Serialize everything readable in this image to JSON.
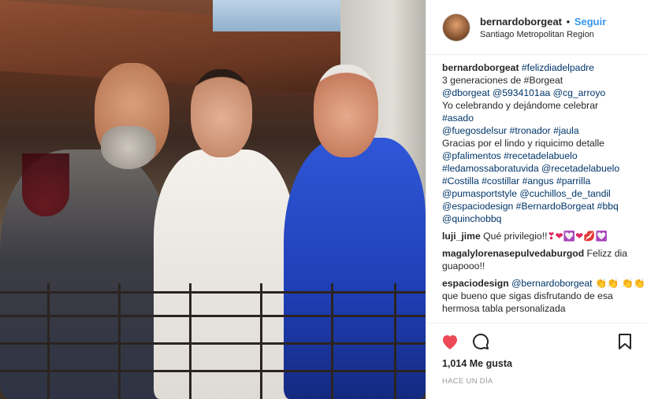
{
  "header": {
    "username": "bernardoborgeat",
    "dot": "•",
    "follow_label": "Seguir",
    "location": "Santiago Metropolitan Region"
  },
  "caption": {
    "username": "bernardoborgeat",
    "lines": [
      "#felizdiadelpadre",
      "3 generaciones de #Borgeat",
      "@dborgeat @5934101aa @cg_arroyo",
      "Yo celebrando y dejándome celebrar",
      "#asado",
      "@fuegosdelsur #tronador #jaula",
      "Gracias por el lindo y riquicimo detalle",
      "@pfalimentos #recetadelabuelo",
      "#ledamossaboratuvida @recetadelabuelo",
      "#Costilla #costillar #angus #parrilla",
      "@pumasportstyle @cuchillos_de_tandil",
      "@espaciodesign #BernardoBorgeat #bbq",
      "@quinchobbq"
    ]
  },
  "comments": [
    {
      "user": "luji_jime",
      "text": "Qué privilegio!!",
      "emoji": "❣❤💟❤💋💟"
    },
    {
      "user": "magalylorenasepulvedaburgod",
      "text": "Felizz dia guapooo!!"
    },
    {
      "user": "espaciodesign",
      "mention": "@bernardoborgeat",
      "emoji1": "👏👏",
      "emoji2": "👏👏",
      "text": "que bueno que sigas disfrutando de esa hermosa tabla personalizada"
    }
  ],
  "actions": {
    "likes": "1,014 Me gusta",
    "time": "HACE UN DÍA"
  },
  "colors": {
    "link": "#003569",
    "follow": "#3897f0",
    "like": "#ed4956"
  }
}
